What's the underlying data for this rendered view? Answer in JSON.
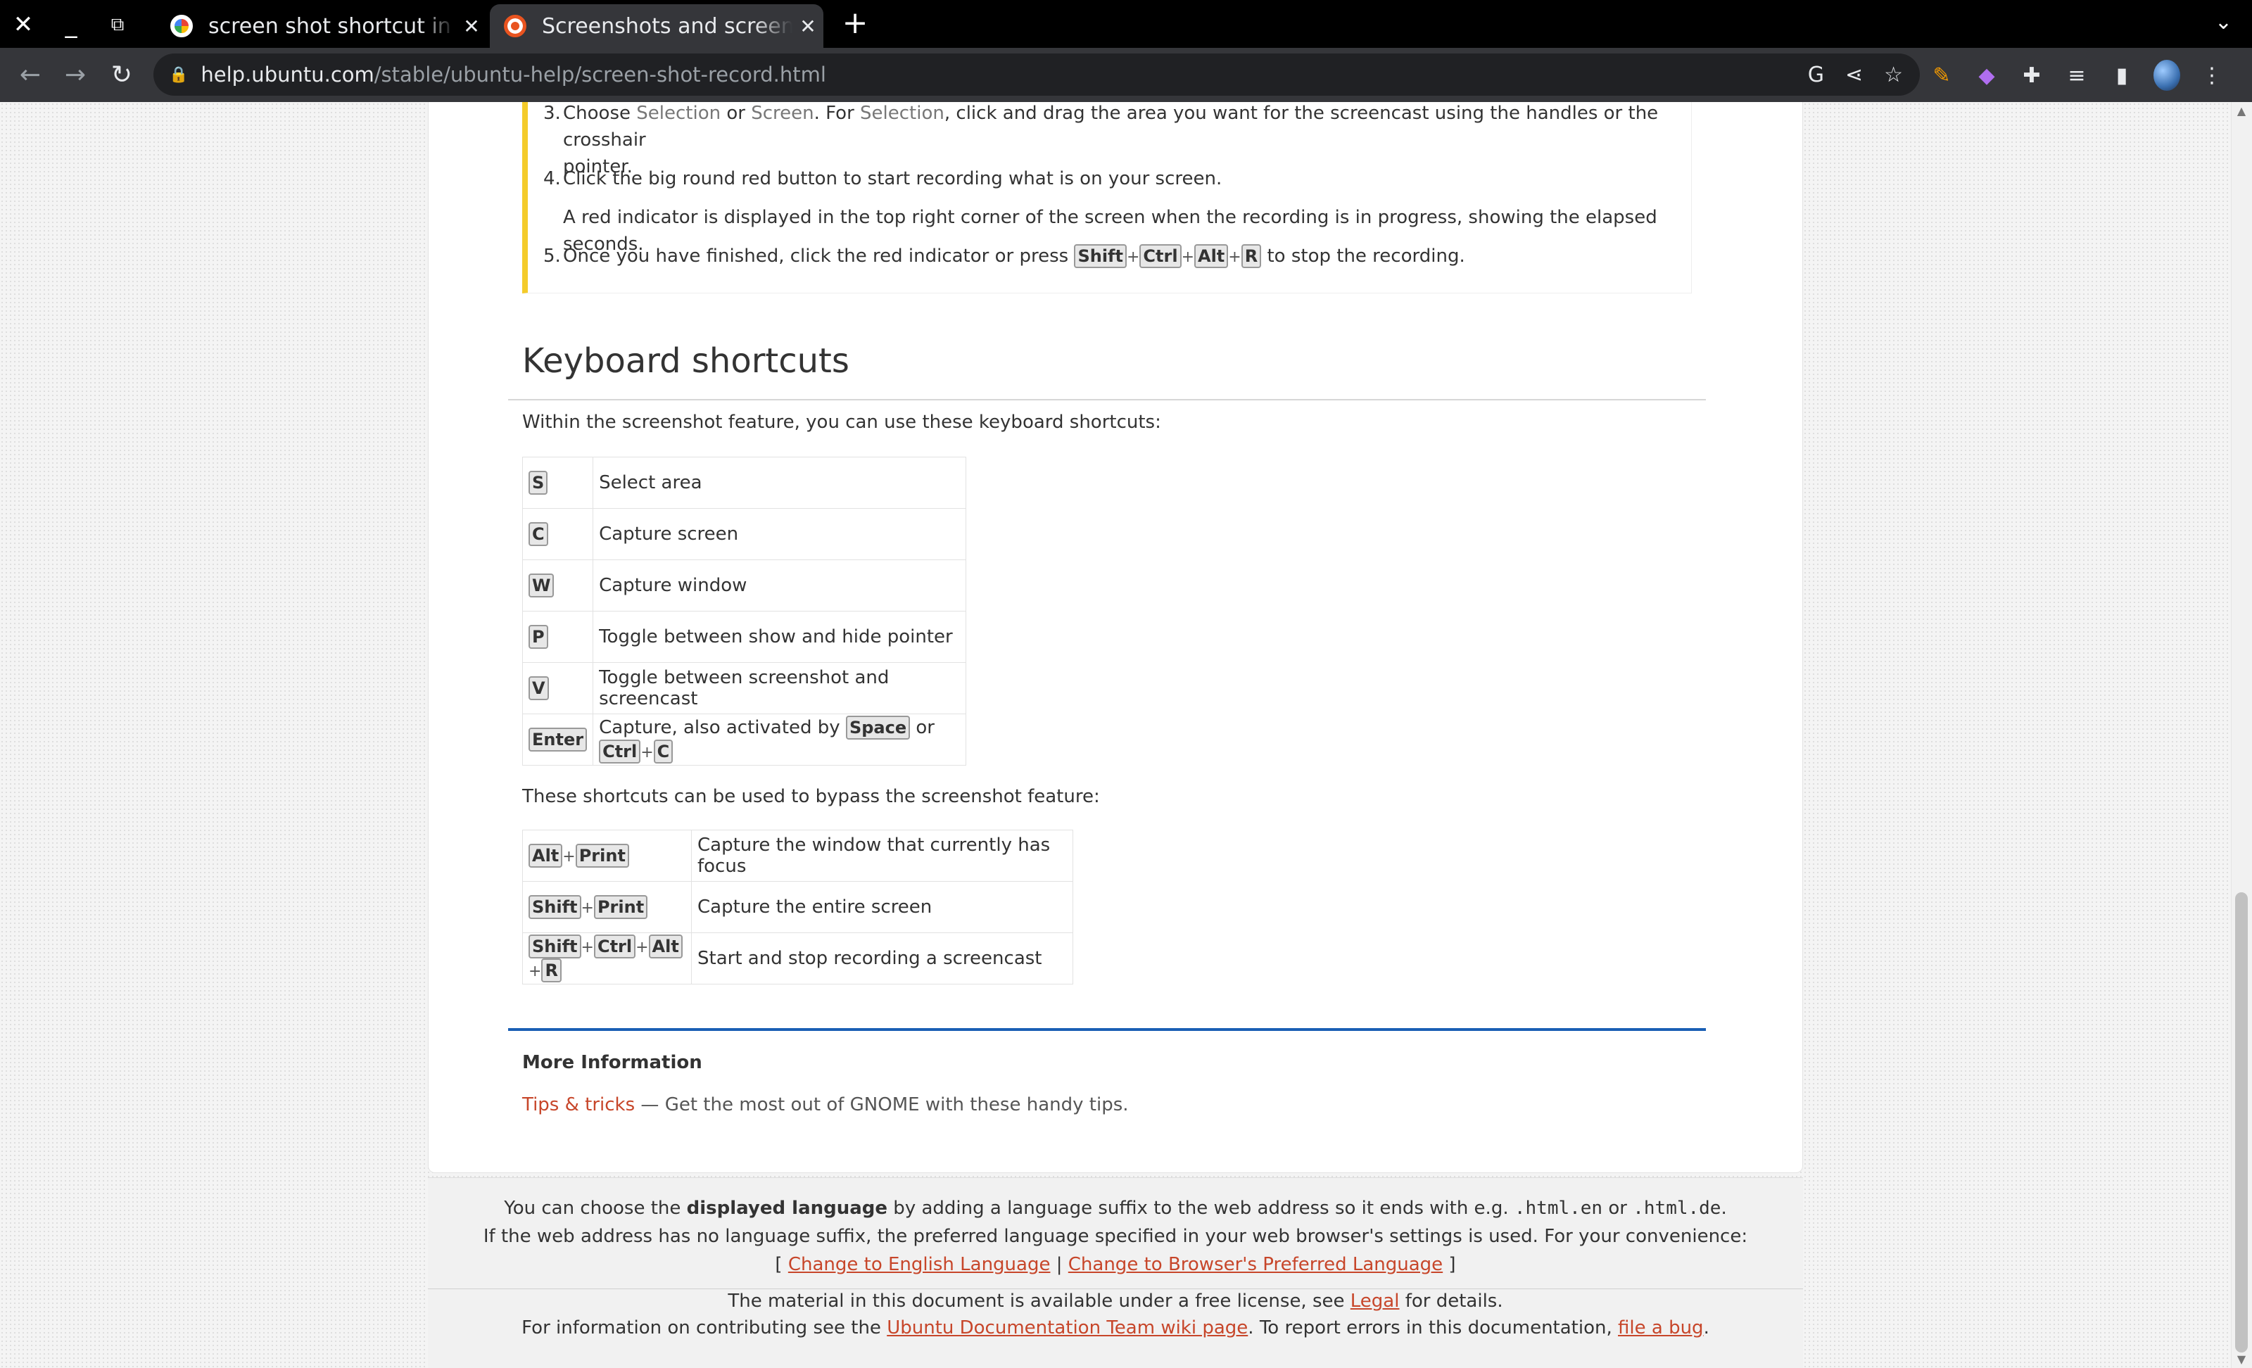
{
  "browser": {
    "tabs": [
      {
        "title": "screen shot shortcut in ubuntu",
        "active": false
      },
      {
        "title": "Screenshots and screencasts",
        "active": true
      }
    ],
    "url_host": "help.ubuntu.com",
    "url_path": "/stable/ubuntu-help/screen-shot-record.html"
  },
  "steps": [
    {
      "num": "3.",
      "pre": "Choose ",
      "kw1": "Selection",
      "mid1": " or ",
      "kw2": "Screen",
      "mid2": ". For ",
      "kw3": "Selection",
      "post": ", click and drag the area you want for the screencast using the handles or the crosshair",
      "cont": "pointer."
    },
    {
      "num": "4.",
      "text": "Click the big round red button to start recording what is on your screen."
    },
    {
      "num": "",
      "text": "A red indicator is displayed in the top right corner of the screen when the recording is in progress, showing the elapsed seconds."
    },
    {
      "num": "5.",
      "pre": "Once you have finished, click the red indicator or press ",
      "keys": [
        "Shift",
        "Ctrl",
        "Alt",
        "R"
      ],
      "post": " to stop the recording."
    }
  ],
  "section_title": "Keyboard shortcuts",
  "intro1": "Within the screenshot feature, you can use these keyboard shortcuts:",
  "shortcuts1": [
    {
      "key": "S",
      "desc": "Select area"
    },
    {
      "key": "C",
      "desc": "Capture screen"
    },
    {
      "key": "W",
      "desc": "Capture window"
    },
    {
      "key": "P",
      "desc": "Toggle between show and hide pointer"
    },
    {
      "key": "V",
      "desc": "Toggle between screenshot and screencast"
    },
    {
      "key": "Enter",
      "desc_pre": "Capture, also activated by ",
      "k1": "Space",
      "desc_mid": " or ",
      "k2": "Ctrl",
      "k3": "C"
    }
  ],
  "intro2": "These shortcuts can be used to bypass the screenshot feature:",
  "shortcuts2": [
    {
      "keys": [
        "Alt",
        "Print"
      ],
      "desc": "Capture the window that currently has focus"
    },
    {
      "keys": [
        "Shift",
        "Print"
      ],
      "desc": "Capture the entire screen"
    },
    {
      "keys": [
        "Shift",
        "Ctrl",
        "Alt",
        "R"
      ],
      "desc": "Start and stop recording a screencast"
    }
  ],
  "more_info": {
    "title": "More Information",
    "link": "Tips & tricks",
    "text": " — Get the most out of GNOME with these handy tips."
  },
  "footer": {
    "l1_pre": "You can choose the ",
    "l1_bold": "displayed language",
    "l1_mid": " by adding a language suffix to the web address so it ends with e.g. ",
    "l1_code1": ".html.en",
    "l1_or": " or ",
    "l1_code2": ".html.de",
    "l1_end": ".",
    "l2": "If the web address has no language suffix, the preferred language specified in your web browser's settings is used. For your convenience:",
    "l3_open": "[ ",
    "l3_link1": "Change to English Language",
    "l3_sep": " | ",
    "l3_link2": "Change to Browser's Preferred Language",
    "l3_close": " ]",
    "l4_pre": "The material in this document is available under a free license, see ",
    "l4_link": "Legal",
    "l4_post": " for details.",
    "l5_pre": "For information on contributing see the ",
    "l5_link1": "Ubuntu Documentation Team wiki page",
    "l5_mid": ". To report errors in this documentation, ",
    "l5_link2": "file a bug",
    "l5_end": "."
  },
  "colors": {
    "accent_link": "#c7462a",
    "note_bar": "#f4cb2a",
    "divider_blue": "#1a5fb4"
  }
}
